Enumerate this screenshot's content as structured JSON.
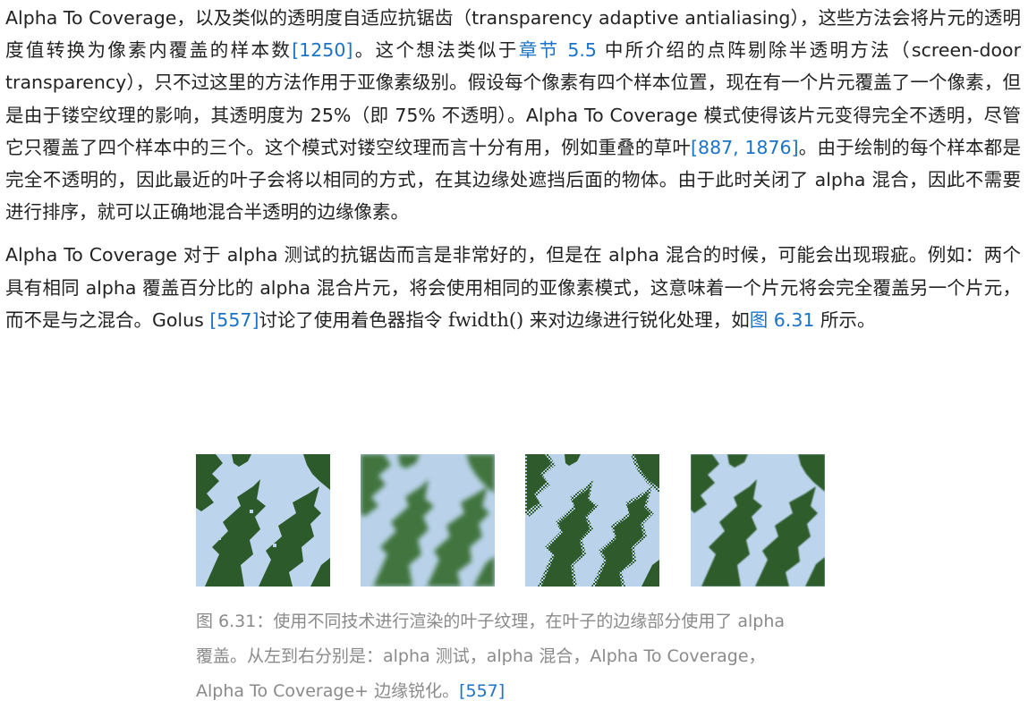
{
  "paragraph1": {
    "t1": "Alpha To Coverage，以及类似的透明度自适应抗锯齿（transparency adaptive antialiasing），这些方法会将片元的透明度值转换为像素内覆盖的样本数",
    "ref1": "[1250]",
    "t2": "。这个想法类似于",
    "ref2": "章节 5.5",
    "t3": " 中所介绍的点阵剔除半透明方法（screen-door transparency），只不过这里的方法作用于亚像素级别。假设每个像素有四个样本位置，现在有一个片元覆盖了一个像素，但是由于镂空纹理的影响，其透明度为 25%（即 75% 不透明）。Alpha To Coverage 模式使得该片元变得完全不透明，尽管它只覆盖了四个样本中的三个。这个模式对镂空纹理而言十分有用，例如重叠的草叶",
    "ref3": "[887, 1876]",
    "t4": "。由于绘制的每个样本都是完全不透明的，因此最近的叶子会将以相同的方式，在其边缘处遮挡后面的物体。由于此时关闭了 alpha 混合，因此不需要进行排序，就可以正确地混合半透明的边缘像素。"
  },
  "paragraph2": {
    "t1": "Alpha To Coverage 对于 alpha 测试的抗锯齿而言是非常好的，但是在 alpha 混合的时候，可能会出现瑕疵。例如：两个具有相同 alpha 覆盖百分比的 alpha 混合片元，将会使用相同的亚像素模式，这意味着一个片元将会完全覆盖另一个片元，而不是与之混合。Golus ",
    "ref1": "[557]",
    "t2": "讨论了使用着色器指令 ",
    "code": "fwidth()",
    "t3": " 来对边缘进行锐化处理，如",
    "ref2": "图 6.31",
    "t4": " 所示。"
  },
  "figure": {
    "caption_t1": "图 6.31：使用不同技术进行渲染的叶子纹理，在叶子的边缘部分使用了 alpha 覆盖。从左到右分别是：alpha 测试，alpha 混合，Alpha To Coverage，Alpha To Coverage+ 边缘锐化。",
    "caption_ref": "[557]",
    "panels": [
      "alpha 测试",
      "alpha 混合",
      "Alpha To Coverage",
      "Alpha To Coverage+ 边缘锐化"
    ]
  },
  "colors": {
    "link": "#1a73c8",
    "leaf_dark": "#2f5b2c",
    "leaf_mid": "#3f7a3a",
    "sky": "#b9d3ea"
  }
}
